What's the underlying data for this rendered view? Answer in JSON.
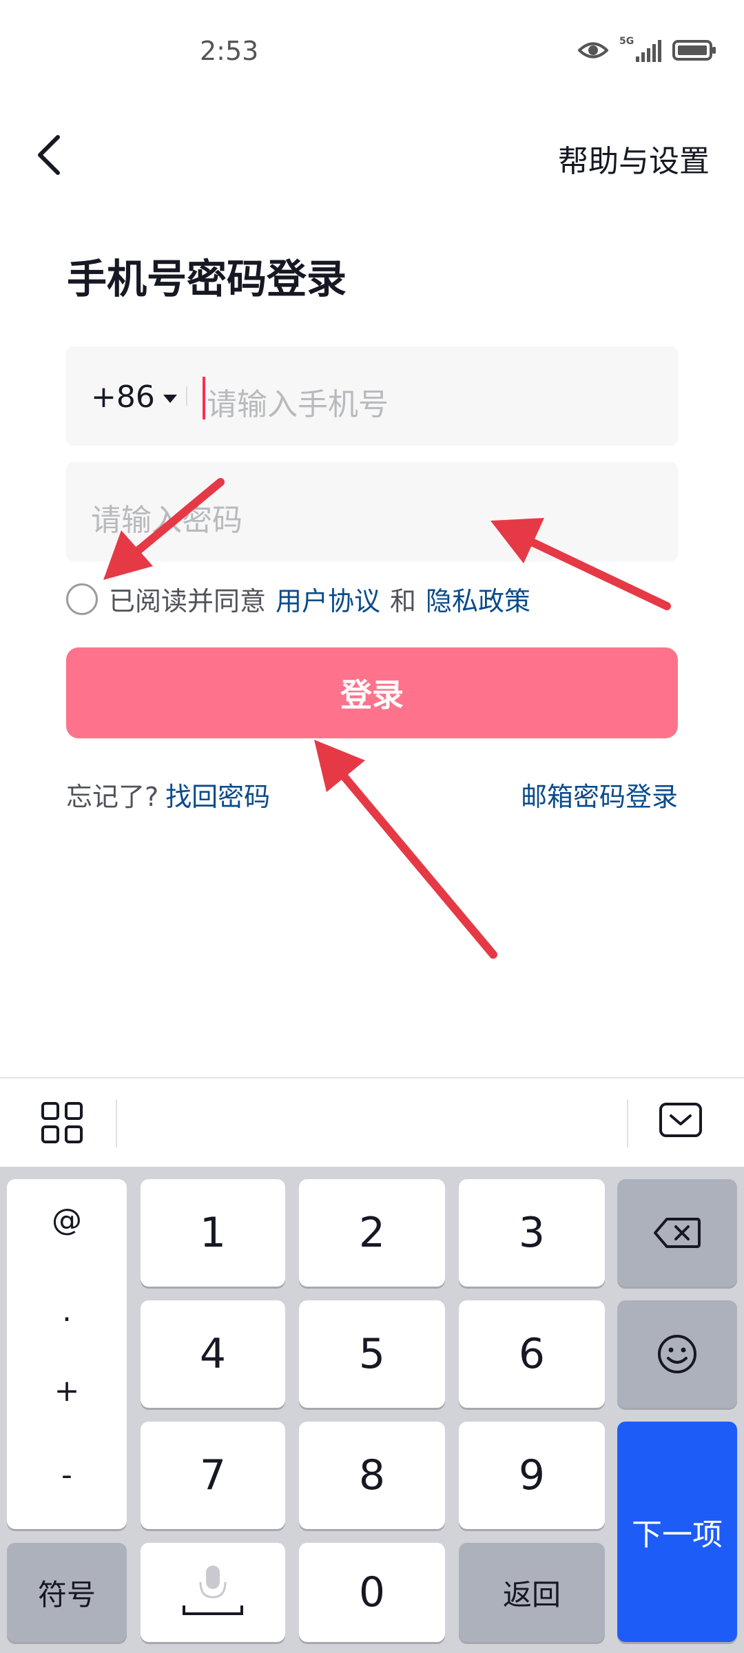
{
  "status_bar": {
    "time": "2:53",
    "network": "5G"
  },
  "header": {
    "help_label": "帮助与设置"
  },
  "title": "手机号密码登录",
  "phone": {
    "country_code": "+86",
    "placeholder": "请输入手机号",
    "value": ""
  },
  "password": {
    "placeholder": "请输入密码",
    "value": ""
  },
  "agreement": {
    "prefix": "已阅读并同意",
    "user_agreement": "用户协议",
    "and": "和",
    "privacy_policy": "隐私政策",
    "checked": false
  },
  "login_button": {
    "label": "登录",
    "color": "#fe738b"
  },
  "forgot": {
    "prefix": "忘记了?",
    "link": "找回密码"
  },
  "email_login": "邮箱密码登录",
  "keyboard": {
    "side_symbols": [
      "@",
      ".",
      "+",
      "-"
    ],
    "digits": [
      "1",
      "2",
      "3",
      "4",
      "5",
      "6",
      "7",
      "8",
      "9",
      "0"
    ],
    "symbols_key": "符号",
    "return_key": "返回",
    "next_key": "下一项",
    "icons": [
      "grid-icon",
      "keyboard-hide-icon",
      "backspace-icon",
      "emoji-icon",
      "microphone-icon",
      "space-icon"
    ]
  },
  "colors": {
    "accent": "#fe2c55",
    "link": "#0a4b8c",
    "next_key": "#1d5cf7",
    "annotation_arrow": "#e63946"
  }
}
